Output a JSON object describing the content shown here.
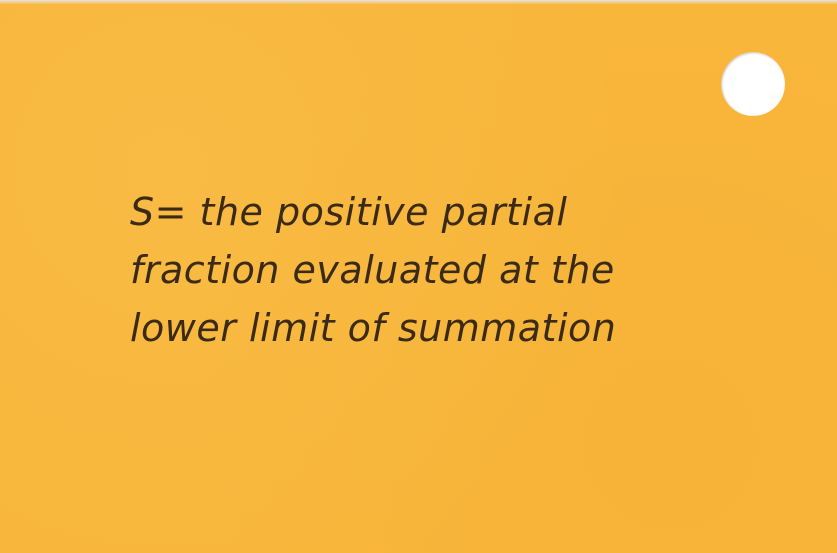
{
  "card": {
    "background_color": "#f8b63b",
    "ink_color": "#3a2a16",
    "lines": [
      "S= the positive partial",
      "fraction evaluated at the",
      "lower limit of summation"
    ]
  }
}
